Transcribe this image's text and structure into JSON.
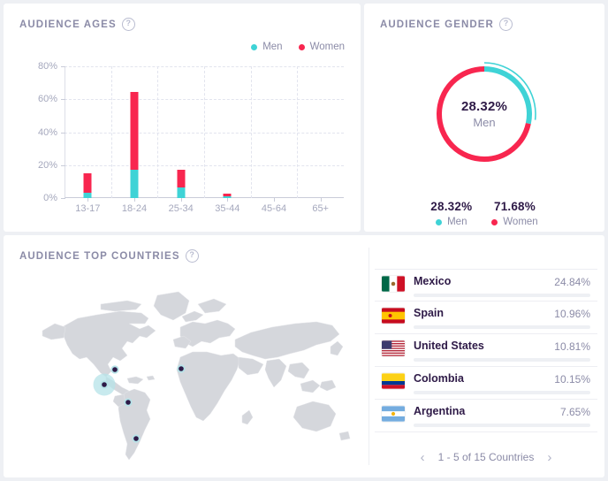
{
  "colors": {
    "men": "#3fd3d6",
    "women": "#f8264f",
    "background": "#eef0f4",
    "card": "#ffffff",
    "title": "#8b8ba7",
    "value": "#2e1a47",
    "grid": "#e2e4ee",
    "map_land": "#d5d7dc",
    "map_highlight": "#b6e3e8",
    "map_pin": "#2e1a47"
  },
  "ages_card": {
    "title": "AUDIENCE AGES",
    "help_icon": "help-circle-icon",
    "legend": [
      {
        "label": "Men",
        "color": "#3fd3d6",
        "icon": "legend-dot-icon"
      },
      {
        "label": "Women",
        "color": "#f8264f",
        "icon": "legend-dot-icon"
      }
    ]
  },
  "gender_card": {
    "title": "AUDIENCE GENDER",
    "help_icon": "help-circle-icon",
    "center_value": "28.32%",
    "center_label": "Men",
    "legend": [
      {
        "value": "28.32%",
        "label": "Men",
        "color": "#3fd3d6",
        "icon": "legend-dot-icon"
      },
      {
        "value": "71.68%",
        "label": "Women",
        "color": "#f8264f",
        "icon": "legend-dot-icon"
      }
    ]
  },
  "countries_card": {
    "title": "AUDIENCE TOP COUNTRIES",
    "help_icon": "help-circle-icon",
    "rows": [
      {
        "name": "Mexico",
        "percent": "24.84%",
        "value": 24.84,
        "flag": "flag-mexico-icon"
      },
      {
        "name": "Spain",
        "percent": "10.96%",
        "value": 10.96,
        "flag": "flag-spain-icon"
      },
      {
        "name": "United States",
        "percent": "10.81%",
        "value": 10.81,
        "flag": "flag-united-states-icon"
      },
      {
        "name": "Colombia",
        "percent": "10.15%",
        "value": 10.15,
        "flag": "flag-colombia-icon"
      },
      {
        "name": "Argentina",
        "percent": "7.65%",
        "value": 7.65,
        "flag": "flag-argentina-icon"
      }
    ],
    "pagination": {
      "prev_icon": "chevron-left-icon",
      "next_icon": "chevron-right-icon",
      "label": "1 - 5 of 15 Countries"
    },
    "map_markers": [
      {
        "name": "United States",
        "x": 112,
        "y": 110,
        "highlight": false
      },
      {
        "name": "Mexico",
        "x": 100,
        "y": 127,
        "highlight": true
      },
      {
        "name": "Spain",
        "x": 187,
        "y": 109,
        "highlight": false
      },
      {
        "name": "Colombia",
        "x": 127,
        "y": 147,
        "highlight": false
      },
      {
        "name": "Argentina",
        "x": 136,
        "y": 188,
        "highlight": false
      }
    ]
  },
  "chart_data": [
    {
      "type": "bar",
      "title": "AUDIENCE AGES",
      "stacked": true,
      "categories": [
        "13-17",
        "18-24",
        "25-34",
        "35-44",
        "45-64",
        "65+"
      ],
      "series": [
        {
          "name": "Men",
          "color": "#3fd3d6",
          "values": [
            3.0,
            17.0,
            6.5,
            1.2,
            0,
            0
          ]
        },
        {
          "name": "Women",
          "color": "#f8264f",
          "values": [
            12.0,
            47.5,
            10.7,
            1.3,
            0,
            0
          ]
        }
      ],
      "totals": [
        15.0,
        64.5,
        17.2,
        2.5,
        0,
        0
      ],
      "xlabel": "",
      "ylabel": "",
      "ylim": [
        0,
        80
      ],
      "yticks": [
        "0%",
        "20%",
        "40%",
        "60%",
        "80%"
      ],
      "ytick_values": [
        0,
        20,
        40,
        60,
        80
      ],
      "grid": true,
      "legend_position": "top-right"
    },
    {
      "type": "pie",
      "title": "AUDIENCE GENDER",
      "donut": true,
      "labels": [
        "Men",
        "Women"
      ],
      "values": [
        28.32,
        71.68
      ],
      "colors": [
        "#3fd3d6",
        "#f8264f"
      ],
      "center_text": "28.32%",
      "center_subtext": "Men",
      "legend_position": "bottom"
    },
    {
      "type": "bar",
      "title": "AUDIENCE TOP COUNTRIES",
      "orientation": "horizontal",
      "categories": [
        "Mexico",
        "Spain",
        "United States",
        "Colombia",
        "Argentina"
      ],
      "values": [
        24.84,
        10.96,
        10.81,
        10.15,
        7.65
      ],
      "color": "#3fd3d6",
      "xlabel": "",
      "ylabel": "",
      "xlim": [
        0,
        100
      ],
      "grid": false,
      "legend_position": "none"
    }
  ]
}
